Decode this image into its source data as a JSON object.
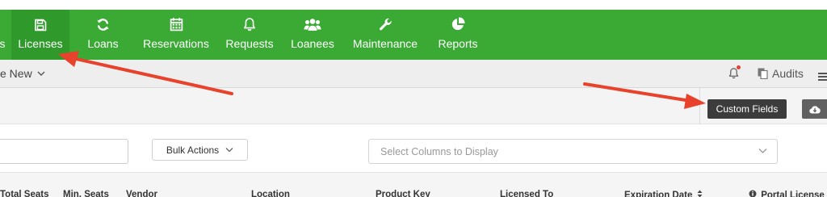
{
  "nav": {
    "items": [
      {
        "label": "s",
        "icon": "partial-icon"
      },
      {
        "label": "Licenses",
        "icon": "floppy-disk-icon"
      },
      {
        "label": "Loans",
        "icon": "refresh-icon"
      },
      {
        "label": "Reservations",
        "icon": "calendar-icon"
      },
      {
        "label": "Requests",
        "icon": "bell-icon"
      },
      {
        "label": "Loanees",
        "icon": "users-icon"
      },
      {
        "label": "Maintenance",
        "icon": "wrench-icon"
      },
      {
        "label": "Reports",
        "icon": "pie-chart-icon"
      }
    ],
    "active": "Licenses"
  },
  "subbar": {
    "create_new": "e New",
    "audits": "Audits"
  },
  "header": {
    "custom_fields": "Custom Fields"
  },
  "toolbar": {
    "search_value": "",
    "bulk_actions": "Bulk Actions",
    "columns_placeholder": "Select Columns to Display"
  },
  "table": {
    "columns": [
      "Total Seats",
      "Min. Seats",
      "Vendor",
      "Location",
      "Product Key",
      "Licensed To",
      "Expiration Date",
      "Portal License"
    ]
  },
  "colors": {
    "nav_green": "#3aaa35",
    "annotation_arrow": "#e8412c",
    "notification_dot": "#e4413a"
  }
}
